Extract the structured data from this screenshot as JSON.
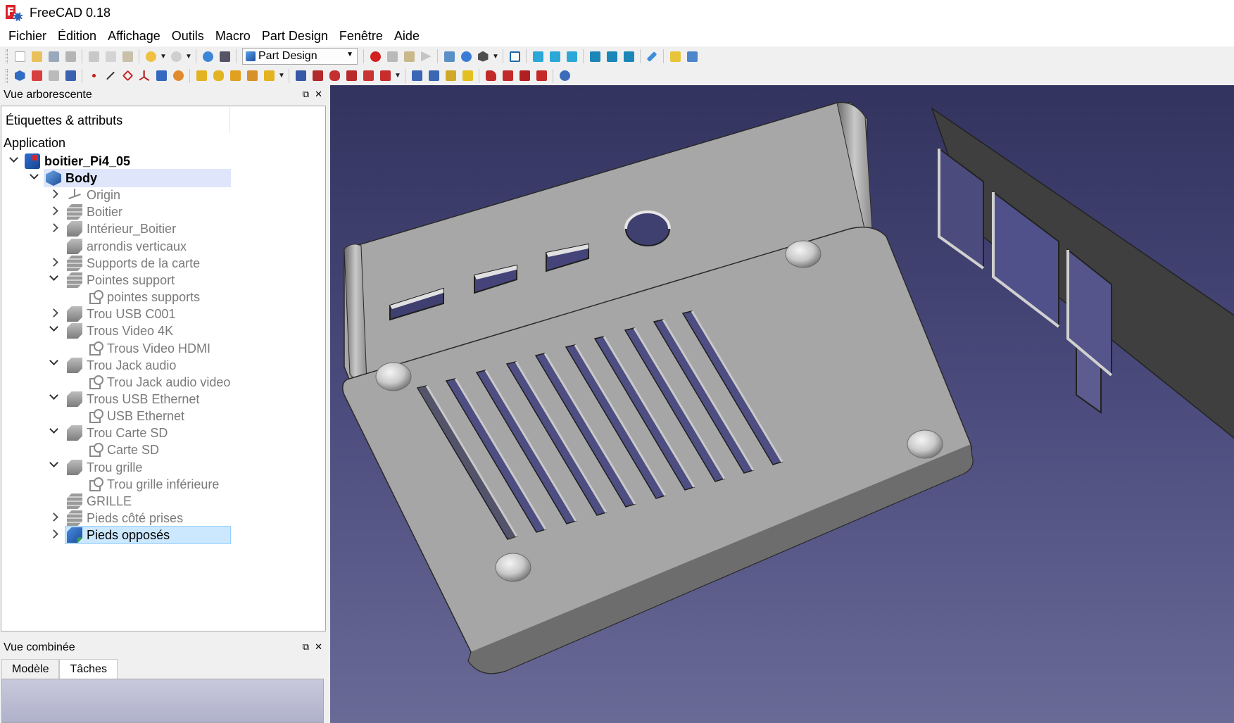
{
  "window": {
    "title": "FreeCAD 0.18",
    "logo_letter": "F"
  },
  "menu": [
    "Fichier",
    "Édition",
    "Affichage",
    "Outils",
    "Macro",
    "Part Design",
    "Fenêtre",
    "Aide"
  ],
  "toolbar": {
    "workbench_selector": "Part Design"
  },
  "tree_panel": {
    "title": "Vue arborescente",
    "header": "Étiquettes & attributs",
    "section": "Application",
    "document": "boitier_Pi4_05",
    "body": "Body",
    "items": [
      {
        "label": "Origin",
        "icon": "origin-icon"
      },
      {
        "label": "Boitier",
        "icon": "pad-icon"
      },
      {
        "label": "Intérieur_Boitier",
        "icon": "pocket-icon"
      },
      {
        "label": "arrondis verticaux",
        "icon": "fillet-icon"
      },
      {
        "label": "Supports de la carte",
        "icon": "pad-icon"
      },
      {
        "label": "Pointes support",
        "icon": "pad-icon"
      },
      {
        "label": "pointes supports",
        "icon": "sketch-icon"
      },
      {
        "label": "Trou USB C001",
        "icon": "pocket-icon"
      },
      {
        "label": "Trous Video 4K",
        "icon": "pocket-icon"
      },
      {
        "label": "Trous Video HDMI",
        "icon": "sketch-icon"
      },
      {
        "label": "Trou Jack audio",
        "icon": "pocket-icon"
      },
      {
        "label": "Trou Jack audio video",
        "icon": "sketch-icon"
      },
      {
        "label": "Trous USB Ethernet",
        "icon": "pocket-icon"
      },
      {
        "label": "USB Ethernet",
        "icon": "sketch-icon"
      },
      {
        "label": "Trou Carte SD",
        "icon": "pocket-icon"
      },
      {
        "label": "Carte SD",
        "icon": "sketch-icon"
      },
      {
        "label": "Trou grille",
        "icon": "pocket-icon"
      },
      {
        "label": "Trou grille inférieure",
        "icon": "sketch-icon"
      },
      {
        "label": "GRILLE",
        "icon": "linear-pattern-icon"
      },
      {
        "label": "Pieds côté prises",
        "icon": "pad-icon"
      },
      {
        "label": "Pieds opposés",
        "icon": "active-feature-icon"
      }
    ]
  },
  "combo_panel": {
    "title": "Vue combinée",
    "tabs": [
      "Modèle",
      "Tâches"
    ]
  },
  "colors": {
    "view_top": "#33335f",
    "view_bottom": "#6a6a97",
    "part_gray": "#a9a9a9",
    "selection_blue": "#cce8ff"
  }
}
